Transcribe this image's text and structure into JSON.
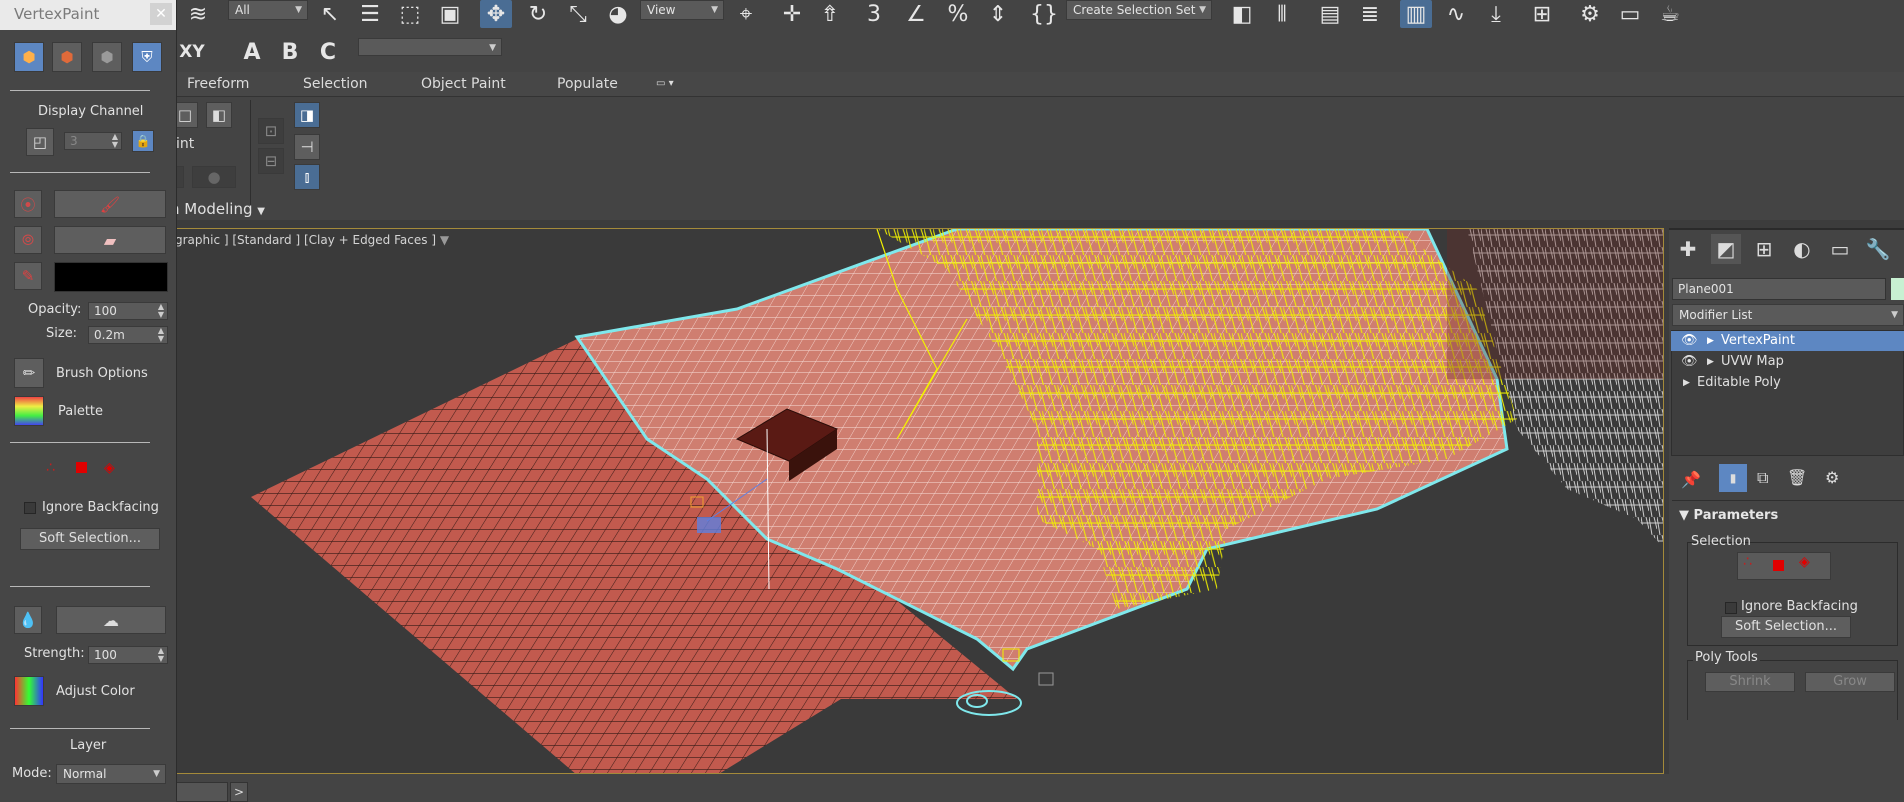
{
  "toolbar": {
    "filter_value": "All",
    "refcoord_value": "View",
    "named_selection": "Create Selection Set",
    "snap_label": "3",
    "angle_label": "∠",
    "percent_label": "%"
  },
  "toolbar2": {
    "xy_label": "XY",
    "a_label": "A",
    "b_label": "B",
    "c_label": "C"
  },
  "ribbon": {
    "tabs": [
      "Freeform",
      "Selection",
      "Object Paint",
      "Populate"
    ],
    "paint_label": "int",
    "group_label": "n Modeling"
  },
  "viewport": {
    "label": "graphic ] [Standard ] [Clay + Edged Faces ]"
  },
  "vertexpaint": {
    "title": "VertexPaint",
    "display_channel_label": "Display Channel",
    "display_channel_value": "3",
    "opacity_label": "Opacity:",
    "opacity_value": "100",
    "size_label": "Size:",
    "size_value": "0.2m",
    "brush_options_label": "Brush Options",
    "palette_label": "Palette",
    "ignore_backfacing_label": "Ignore Backfacing",
    "soft_selection_label": "Soft Selection...",
    "strength_label": "Strength:",
    "strength_value": "100",
    "adjust_color_label": "Adjust Color",
    "layer_label": "Layer",
    "mode_label": "Mode:",
    "mode_value": "Normal",
    "paint_color": "#000000"
  },
  "command_panel": {
    "object_name": "Plane001",
    "modifier_list_label": "Modifier List",
    "stack": [
      "VertexPaint",
      "UVW Map",
      "Editable Poly"
    ],
    "parameters_label": "Parameters",
    "selection_label": "Selection",
    "ignore_backfacing_label": "Ignore Backfacing",
    "soft_selection_label": "Soft Selection...",
    "poly_tools_label": "Poly Tools",
    "shrink_label": "Shrink",
    "grow_label": "Grow",
    "object_color": "#c8f0d2"
  },
  "statusbar": {
    "arrow": ">"
  },
  "colors": {
    "accent_blue": "#5d87c2",
    "viewport_border": "#a48a3a",
    "terrain": "#c25a4e",
    "wire_yellow": "#f0f000",
    "selection_cyan": "#7fe8ec"
  }
}
